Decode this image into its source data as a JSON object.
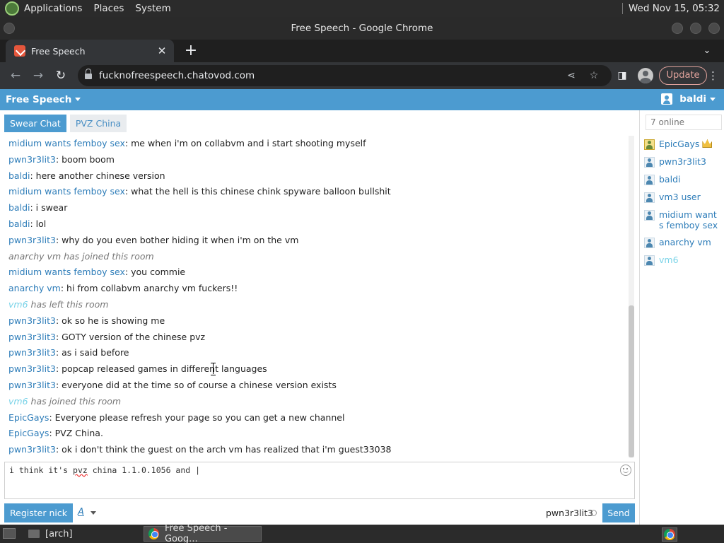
{
  "gnome_panel": {
    "menus": [
      "Applications",
      "Places",
      "System"
    ],
    "clock": "Wed Nov 15, 05:32"
  },
  "window": {
    "title": "Free Speech - Google Chrome"
  },
  "browser": {
    "tab_title": "Free Speech",
    "tab_close": "✕",
    "new_tab": "+",
    "url": "fucknofreespeech.chatovod.com",
    "update_label": "Update"
  },
  "chat": {
    "room_title": "Free Speech",
    "current_user": "baldi",
    "tabs": [
      {
        "label": "Swear Chat",
        "active": true
      },
      {
        "label": "PVZ China",
        "active": false
      }
    ],
    "messages": [
      {
        "nick": "midium wants femboy sex",
        "text": "me when i'm on collabvm and i start shooting myself"
      },
      {
        "nick": "pwn3r3lit3",
        "text": "boom boom"
      },
      {
        "nick": "baldi",
        "text": "here another chinese version"
      },
      {
        "nick": "midium wants femboy sex",
        "text": "what the hell is this chinese chink spyware balloon bullshit"
      },
      {
        "nick": "baldi",
        "text": "i swear"
      },
      {
        "nick": "baldi",
        "text": "lol"
      },
      {
        "nick": "pwn3r3lit3",
        "text": "why do you even bother hiding it when i'm on the vm"
      },
      {
        "system": "anarchy vm has joined this room"
      },
      {
        "nick": "midium wants femboy sex",
        "text": "you commie"
      },
      {
        "nick": "anarchy vm",
        "text": "hi from collabvm anarchy vm fuckers!!"
      },
      {
        "nick": "vm6",
        "system": "has left this room"
      },
      {
        "nick": "pwn3r3lit3",
        "text": "ok so he is showing me"
      },
      {
        "nick": "pwn3r3lit3",
        "text": "GOTY version of the chinese pvz"
      },
      {
        "nick": "pwn3r3lit3",
        "text": "as i said before"
      },
      {
        "nick": "pwn3r3lit3",
        "text": "popcap released games in different languages"
      },
      {
        "nick": "pwn3r3lit3",
        "text": "everyone did at the time so of course a chinese version exists"
      },
      {
        "nick": "vm6",
        "system": "has joined this room"
      },
      {
        "nick": "EpicGays",
        "text": "Everyone please refresh your page so you can get a new channel"
      },
      {
        "nick": "EpicGays",
        "text": "PVZ China."
      },
      {
        "nick": "pwn3r3lit3",
        "text": "ok i don't think the guest on the arch vm has realized that i'm guest33038"
      }
    ],
    "input": {
      "before": "i think it's ",
      "misspelled": "pvz",
      "after": " china 1.1.0.1056 and "
    },
    "register_label": "Register nick",
    "font_label": "A",
    "nick_label": "pwn3r3lit3",
    "send_label": "Send"
  },
  "sidebar": {
    "online_count": "7 online",
    "users": [
      {
        "name": "EpicGays",
        "gold": true,
        "crown": true
      },
      {
        "name": "pwn3r3lit3"
      },
      {
        "name": "baldi"
      },
      {
        "name": "vm3 user"
      },
      {
        "name": "midium want s femboy sex"
      },
      {
        "name": "anarchy vm"
      },
      {
        "name": "vm6",
        "cyan": true
      }
    ]
  },
  "taskbar": {
    "items": [
      {
        "label": "[arch]",
        "icon": "folder-icon",
        "active": false
      },
      {
        "label": "Free Speech - Goog...",
        "icon": "chrome-icon",
        "active": true
      }
    ]
  },
  "colors": {
    "accent": "#4c9bd0",
    "nick": "#2e7db9",
    "guest_nick": "#7ad3e8",
    "update_outline": "#e0a29b"
  },
  "cyan_nicks": [
    "vm6"
  ]
}
